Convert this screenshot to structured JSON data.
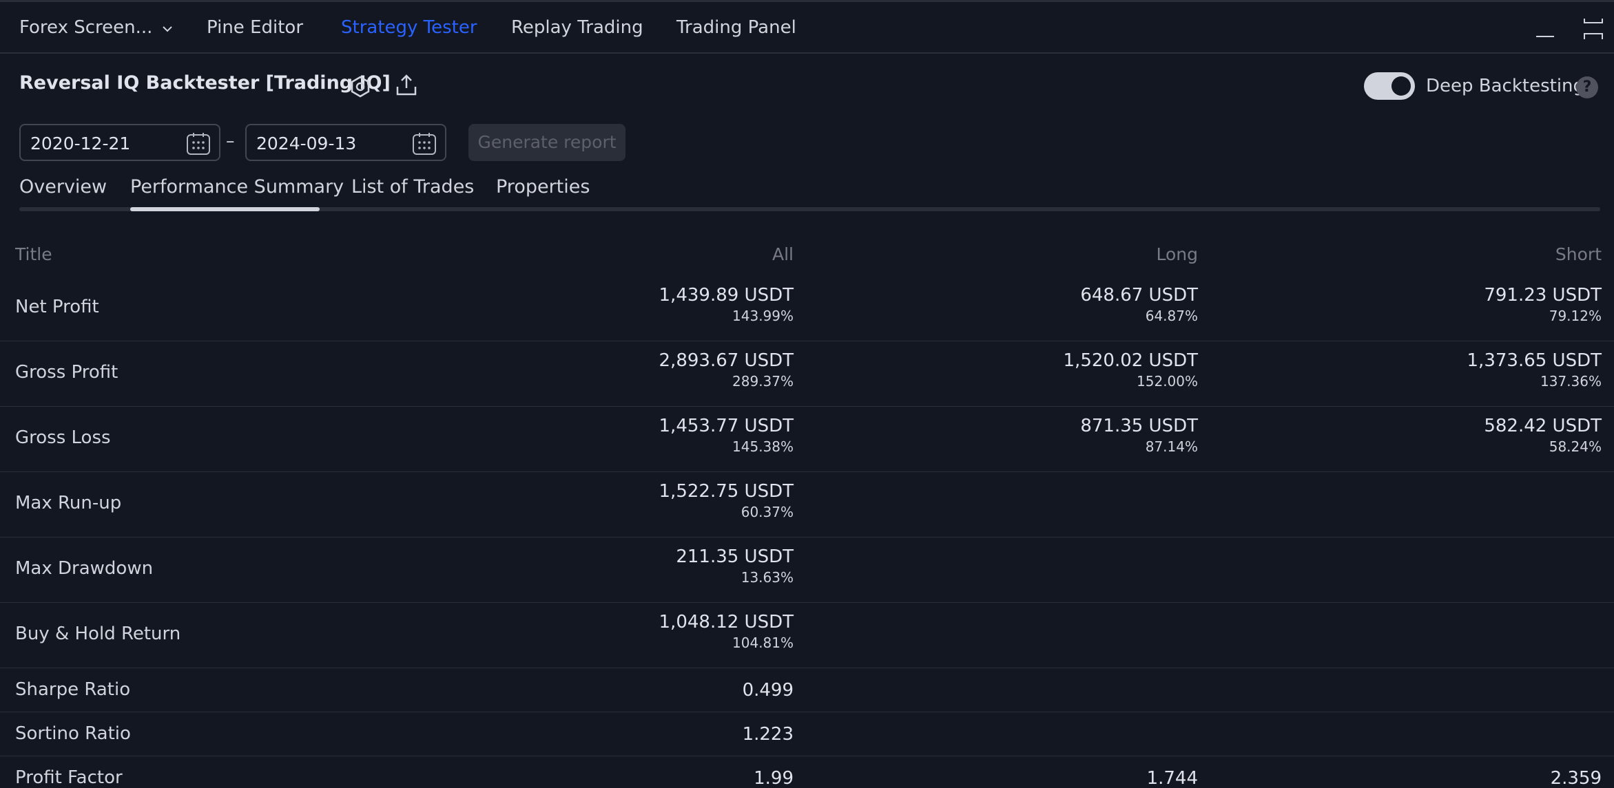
{
  "top_tabs": {
    "screener": "Forex Screen...",
    "pine_editor": "Pine Editor",
    "strategy_tester": "Strategy Tester",
    "replay_trading": "Replay Trading",
    "trading_panel": "Trading Panel"
  },
  "strategy": {
    "title": "Reversal IQ Backtester [Trading IQ]",
    "deep_backtesting_label": "Deep Backtesting",
    "deep_backtesting_enabled": true,
    "help": "?"
  },
  "date_range": {
    "start": "2020-12-21",
    "separator": "–",
    "end": "2024-09-13",
    "generate_label": "Generate report"
  },
  "sub_tabs": {
    "overview": "Overview",
    "performance_summary": "Performance Summary",
    "list_of_trades": "List of Trades",
    "properties": "Properties"
  },
  "table": {
    "headers": {
      "title": "Title",
      "all": "All",
      "long": "Long",
      "short": "Short"
    },
    "rows": [
      {
        "title": "Net Profit",
        "all": "1,439.89 USDT",
        "all_pct": "143.99%",
        "long": "648.67 USDT",
        "long_pct": "64.87%",
        "short": "791.23 USDT",
        "short_pct": "79.12%"
      },
      {
        "title": "Gross Profit",
        "all": "2,893.67 USDT",
        "all_pct": "289.37%",
        "long": "1,520.02 USDT",
        "long_pct": "152.00%",
        "short": "1,373.65 USDT",
        "short_pct": "137.36%"
      },
      {
        "title": "Gross Loss",
        "all": "1,453.77 USDT",
        "all_pct": "145.38%",
        "long": "871.35 USDT",
        "long_pct": "87.14%",
        "short": "582.42 USDT",
        "short_pct": "58.24%"
      },
      {
        "title": "Max Run-up",
        "all": "1,522.75 USDT",
        "all_pct": "60.37%"
      },
      {
        "title": "Max Drawdown",
        "all": "211.35 USDT",
        "all_pct": "13.63%"
      },
      {
        "title": "Buy & Hold Return",
        "all": "1,048.12 USDT",
        "all_pct": "104.81%"
      },
      {
        "title": "Sharpe Ratio",
        "all": "0.499"
      },
      {
        "title": "Sortino Ratio",
        "all": "1.223"
      },
      {
        "title": "Profit Factor",
        "all": "1.99",
        "long": "1.744",
        "short": "2.359"
      }
    ]
  },
  "colors": {
    "background": "#131722",
    "accent": "#2962ff",
    "border": "#2a2e39",
    "muted_text": "#787b86"
  }
}
